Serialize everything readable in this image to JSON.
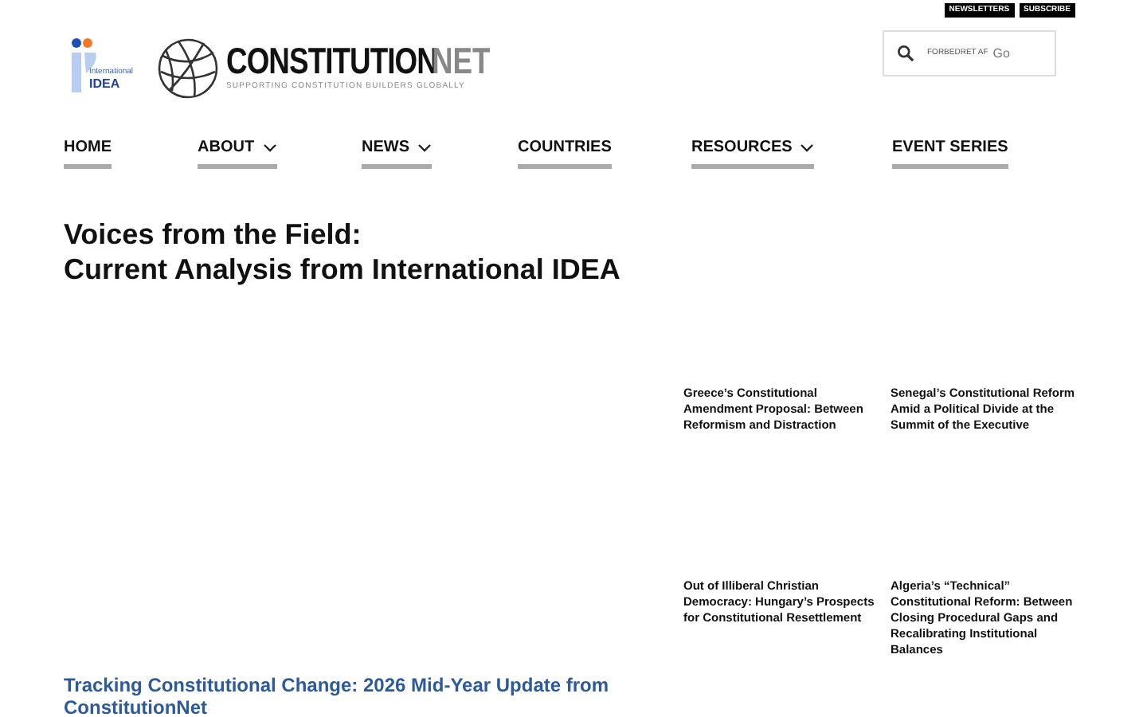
{
  "top_links": [
    "NEWSLETTERS",
    "SUBSCRIBE"
  ],
  "logo": {
    "idea_small": "International",
    "idea": "IDEA",
    "brand": "CONSTITUTION",
    "brand_suffix": "NET",
    "tagline": "SUPPORTING CONSTITUTION BUILDERS GLOBALLY"
  },
  "search": {
    "placeholder": "FORBEDRET AF",
    "provider": "Go"
  },
  "nav": [
    {
      "label": "HOME",
      "dropdown": false
    },
    {
      "label": "ABOUT",
      "dropdown": true
    },
    {
      "label": "NEWS",
      "dropdown": true
    },
    {
      "label": "COUNTRIES",
      "dropdown": false
    },
    {
      "label": "RESOURCES",
      "dropdown": true
    },
    {
      "label": "EVENT SERIES",
      "dropdown": false
    }
  ],
  "heading": [
    "Voices from the Field:",
    "Current Analysis from International IDEA"
  ],
  "articles": [
    {
      "title": "Greece’s Constitutional Amendment Proposal: Between Reformism and Distraction"
    },
    {
      "title": "Senegal’s Constitutional Reform Amid a Political Divide at the Summit of the Executive"
    },
    {
      "title": "Out of Illiberal Christian Democracy: Hungary’s Prospects for Constitutional Resettlement"
    },
    {
      "title": "Algeria’s “Technical” Constitutional Reform: Between Closing Procedural Gaps and Recalibrating Institutional Balances"
    }
  ],
  "featured": {
    "title": "Tracking Constitutional Change: 2026 Mid-Year Update from ConstitutionNet"
  }
}
